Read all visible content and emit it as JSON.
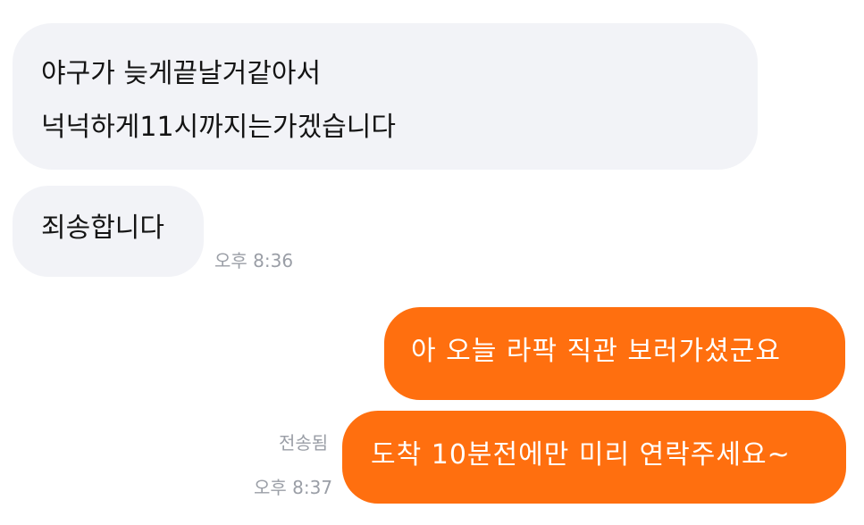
{
  "messages": [
    {
      "direction": "incoming",
      "lines": [
        "야구가 늦게끝날거같아서",
        "넉넉하게11시까지는가겠습니다"
      ]
    },
    {
      "direction": "incoming",
      "text": "죄송합니다",
      "time": "오후 8:36"
    },
    {
      "direction": "outgoing",
      "text": "아 오늘 라팍 직관 보러가셨군요"
    },
    {
      "direction": "outgoing",
      "text": "도착 10분전에만 미리 연락주세요~",
      "status": "전송됨",
      "time": "오후 8:37"
    }
  ],
  "colors": {
    "incoming_bubble": "#f2f3f7",
    "outgoing_bubble": "#ff6f0f",
    "outgoing_text": "#ffffff",
    "meta_text": "#9a9ea6"
  }
}
